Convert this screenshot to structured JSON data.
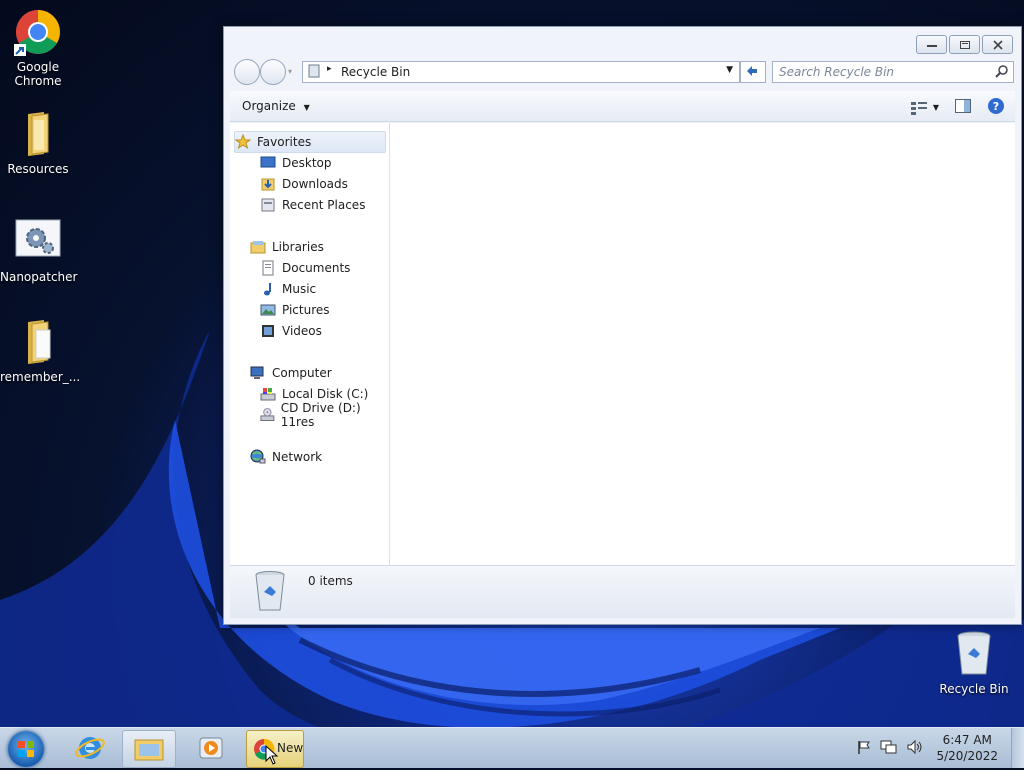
{
  "desktop": {
    "icons": [
      {
        "label": "Google Chrome",
        "icon": "chrome-icon"
      },
      {
        "label": "Resources",
        "icon": "folder-icon"
      },
      {
        "label": "Nanopatcher",
        "icon": "gear-icon"
      },
      {
        "label": "remember_...",
        "icon": "folder-icon"
      },
      {
        "label": "Recycle Bin",
        "icon": "recycle-bin-icon"
      }
    ]
  },
  "window": {
    "address": "Recycle Bin",
    "search_placeholder": "Search Recycle Bin",
    "toolbar": {
      "organize": "Organize"
    },
    "nav": {
      "favorites": "Favorites",
      "desktop": "Desktop",
      "downloads": "Downloads",
      "recent": "Recent Places",
      "libraries": "Libraries",
      "documents": "Documents",
      "music": "Music",
      "pictures": "Pictures",
      "videos": "Videos",
      "computer": "Computer",
      "local_disk": "Local Disk (C:)",
      "cd_drive": "CD Drive (D:) 11res",
      "network": "Network"
    },
    "details": {
      "count": "0 items"
    }
  },
  "taskbar": {
    "chrome_label": "New",
    "time": "6:47 AM",
    "date": "5/20/2022"
  },
  "colors": {
    "accent": "#1a5fb0",
    "taskbar": "#bccbe0"
  }
}
